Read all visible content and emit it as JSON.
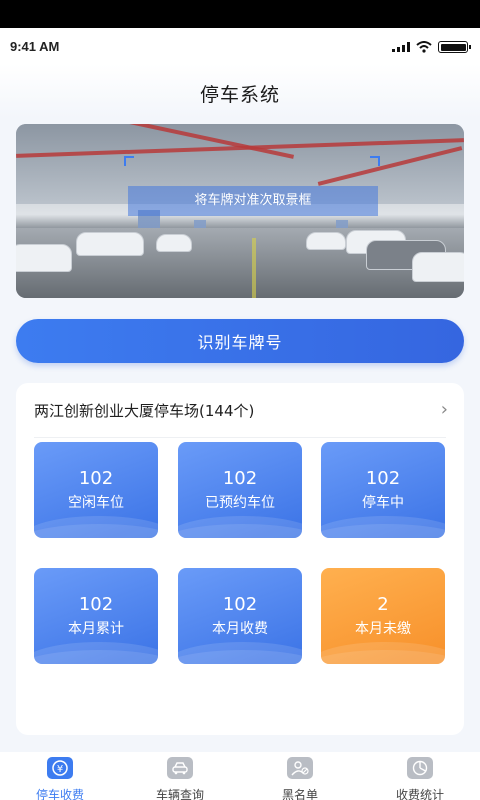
{
  "status": {
    "time": "9:41 AM"
  },
  "header": {
    "title": "停车系统"
  },
  "camera": {
    "hint": "将车牌对准次取景框"
  },
  "recognize_button": {
    "label": "识别车牌号"
  },
  "lot": {
    "name": "两江创新创业大厦停车场(144个)",
    "stats": [
      {
        "value": "102",
        "label": "空闲车位",
        "color": "blue"
      },
      {
        "value": "102",
        "label": "已预约车位",
        "color": "blue"
      },
      {
        "value": "102",
        "label": "停车中",
        "color": "blue"
      },
      {
        "value": "102",
        "label": "本月累计",
        "color": "blue"
      },
      {
        "value": "102",
        "label": "本月收费",
        "color": "blue"
      },
      {
        "value": "2",
        "label": "本月未缴",
        "color": "orange"
      }
    ]
  },
  "tabs": [
    {
      "label": "停车收费",
      "icon": "yen-icon",
      "active": true
    },
    {
      "label": "车辆查询",
      "icon": "car-icon",
      "active": false
    },
    {
      "label": "黑名单",
      "icon": "user-block-icon",
      "active": false
    },
    {
      "label": "收费统计",
      "icon": "pie-chart-icon",
      "active": false
    }
  ],
  "colors": {
    "primary": "#3d7cf0",
    "accent_orange": "#f7902a"
  }
}
